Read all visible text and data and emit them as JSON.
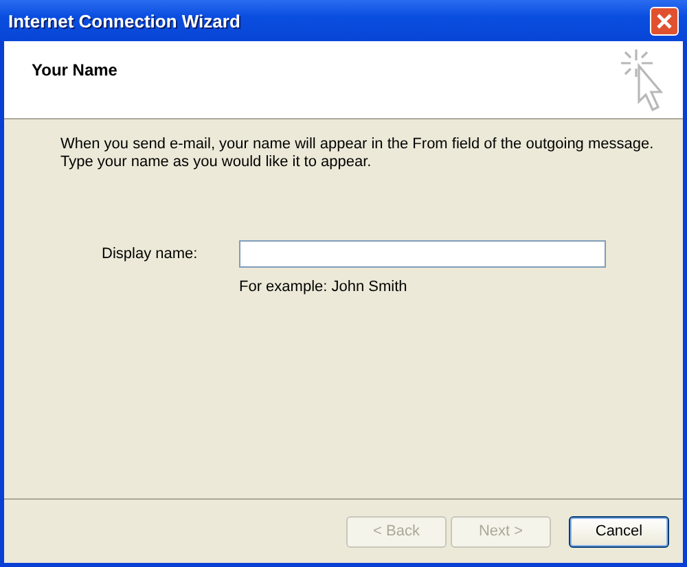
{
  "window": {
    "title": "Internet Connection Wizard"
  },
  "header": {
    "title": "Your Name"
  },
  "description": [
    "When you send e-mail, your name will appear in the From field of the outgoing message.",
    "Type your name as you would like it to appear."
  ],
  "field": {
    "label": "Display name:",
    "example": "For example: John Smith"
  },
  "buttons": [
    {
      "label": "< Back",
      "disabled": true,
      "default": false
    },
    {
      "label": "Next >",
      "disabled": true,
      "default": false
    },
    {
      "label": "Cancel",
      "disabled": false,
      "default": true
    }
  ]
}
